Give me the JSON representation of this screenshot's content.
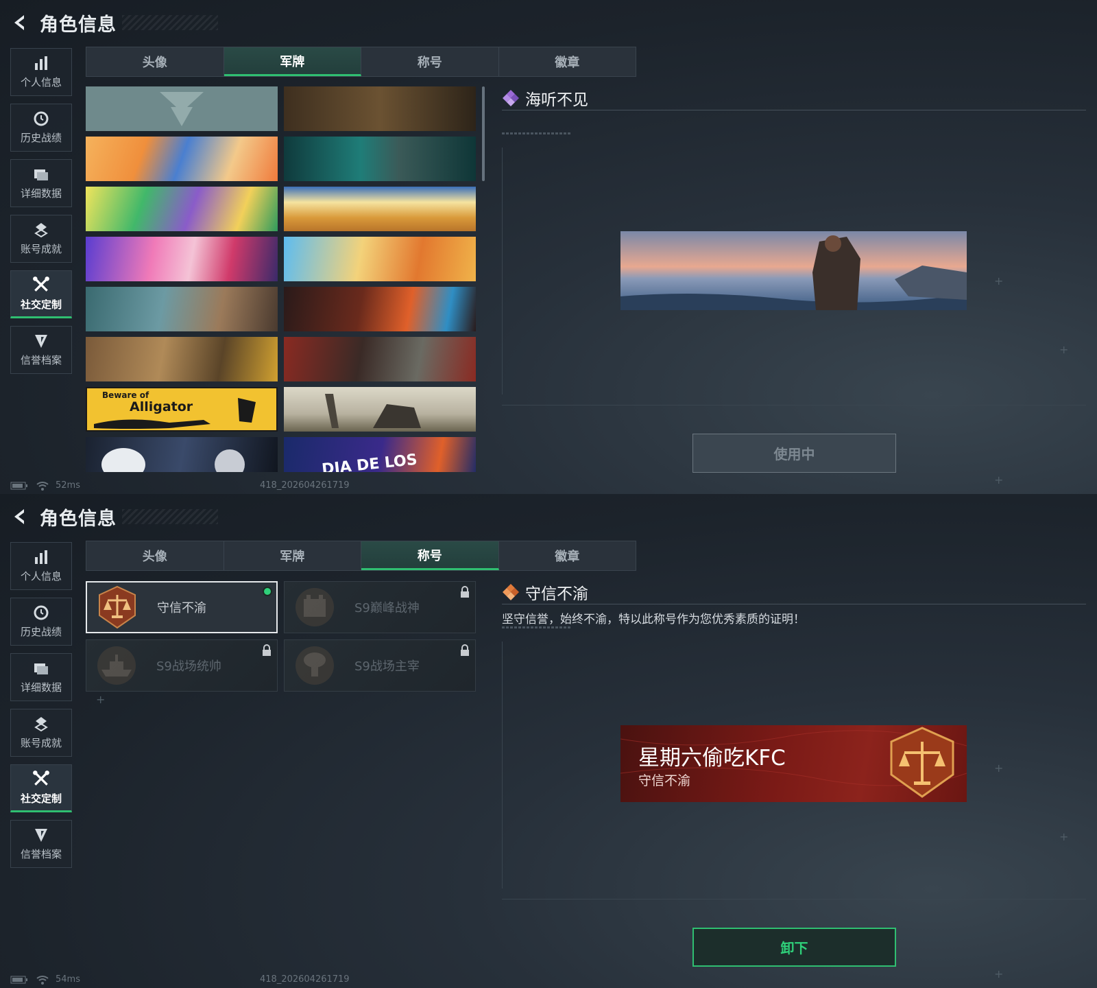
{
  "header": {
    "title": "角色信息"
  },
  "sidebar": {
    "items": [
      {
        "label": "个人信息",
        "icon": "bar-chart-icon"
      },
      {
        "label": "历史战绩",
        "icon": "clock-icon"
      },
      {
        "label": "详细数据",
        "icon": "folder-icon"
      },
      {
        "label": "账号成就",
        "icon": "achievement-icon"
      },
      {
        "label": "社交定制",
        "icon": "tools-icon"
      },
      {
        "label": "信誉档案",
        "icon": "shield-icon"
      }
    ],
    "active_index": 4
  },
  "tabs": [
    "头像",
    "军牌",
    "称号",
    "徽章"
  ],
  "screens": {
    "top": {
      "active_tab": "军牌",
      "detail_title": "海听不见",
      "button": "使用中",
      "latency": "52ms",
      "build": "418_202604261719"
    },
    "bottom": {
      "active_tab": "称号",
      "detail_title": "守信不渝",
      "detail_desc": "坚守信誉，始终不渝，特以此称号作为您优秀素质的证明！",
      "titles": [
        {
          "name": "守信不渝",
          "locked": false,
          "selected": true,
          "icon": "scales-medal-icon"
        },
        {
          "name": "S9巅峰战神",
          "locked": true,
          "selected": false,
          "icon": "fortress-medal-icon"
        },
        {
          "name": "S9战场统帅",
          "locked": true,
          "selected": false,
          "icon": "warship-medal-icon"
        },
        {
          "name": "S9战场主宰",
          "locked": true,
          "selected": false,
          "icon": "explosion-medal-icon"
        }
      ],
      "preview": {
        "name": "星期六偷吃KFC",
        "title": "守信不渝"
      },
      "button": "卸下",
      "latency": "54ms",
      "build": "418_202604261719"
    }
  },
  "dog_tag_banner_text": {
    "alligator_small": "Beware of",
    "alligator_big": "Alligator",
    "dia": "DIA DE LOS"
  },
  "colors": {
    "accent": "#2fbf71",
    "active_tab_bg": "#2a4a46",
    "title_card_red": "#7a1a16"
  }
}
